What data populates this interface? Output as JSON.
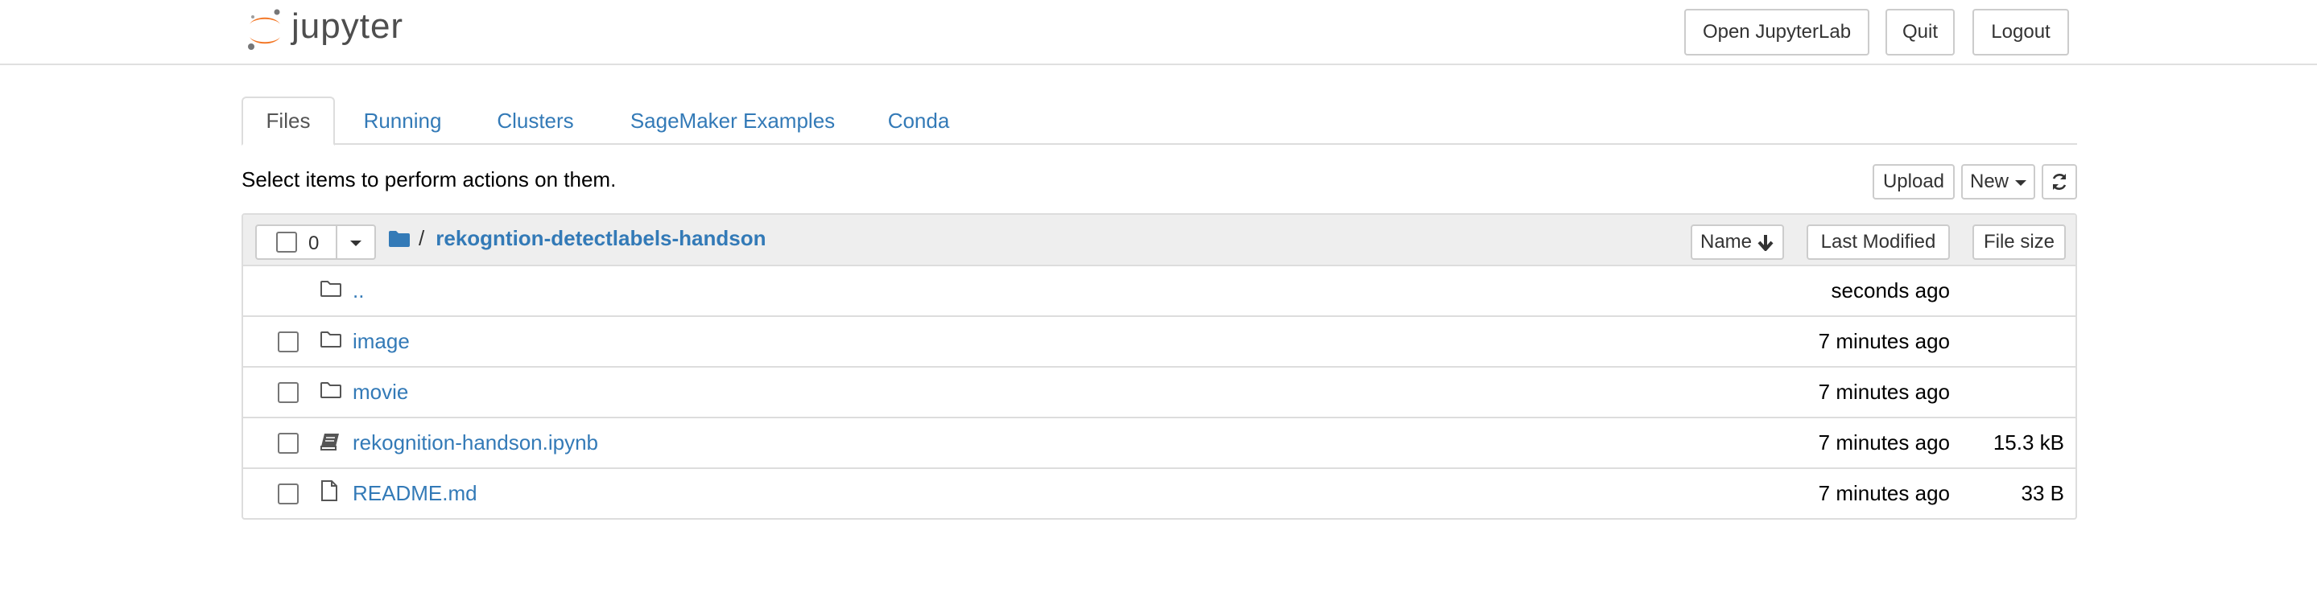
{
  "brand": {
    "logo_text": "jupyter"
  },
  "header_buttons": {
    "open_jupyterlab": "Open JupyterLab",
    "quit": "Quit",
    "logout": "Logout"
  },
  "tabs": [
    {
      "label": "Files",
      "active": true
    },
    {
      "label": "Running",
      "active": false
    },
    {
      "label": "Clusters",
      "active": false
    },
    {
      "label": "SageMaker Examples",
      "active": false
    },
    {
      "label": "Conda",
      "active": false
    }
  ],
  "toolbar": {
    "hint": "Select items to perform actions on them.",
    "upload_label": "Upload",
    "new_label": "New"
  },
  "list_header": {
    "selected_count": "0",
    "breadcrumb_sep": "/",
    "current_dir": "rekogntion-detectlabels-handson",
    "sort_name": "Name",
    "sort_modified": "Last Modified",
    "sort_size": "File size"
  },
  "items": [
    {
      "name": "..",
      "type": "parent",
      "modified": "seconds ago",
      "size": ""
    },
    {
      "name": "image",
      "type": "folder",
      "modified": "7 minutes ago",
      "size": ""
    },
    {
      "name": "movie",
      "type": "folder",
      "modified": "7 minutes ago",
      "size": ""
    },
    {
      "name": "rekognition-handson.ipynb",
      "type": "notebook",
      "modified": "7 minutes ago",
      "size": "15.3 kB"
    },
    {
      "name": "README.md",
      "type": "file",
      "modified": "7 minutes ago",
      "size": "33 B"
    }
  ],
  "colors": {
    "link": "#337ab7",
    "border": "#dddddd",
    "logo_orange": "#f37726",
    "logo_gray": "#767677"
  }
}
